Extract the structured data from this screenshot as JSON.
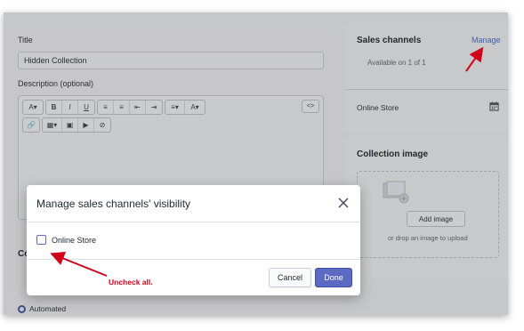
{
  "form": {
    "title_label": "Title",
    "title_value": "Hidden Collection",
    "description_label": "Description (optional)",
    "toolbar": {
      "font": "A",
      "bold": "B",
      "italic": "I",
      "underline": "U",
      "text_color": "A",
      "code": "<>"
    },
    "conditions_heading_partial": "Co",
    "automated_label": "Automated"
  },
  "sales_channels": {
    "title": "Sales channels",
    "manage_link": "Manage",
    "availability": "Available on 1 of 1",
    "channel": "Online Store"
  },
  "collection_image": {
    "title": "Collection image",
    "add_button": "Add image",
    "drop_hint": "or drop an image to upload"
  },
  "modal": {
    "title": "Manage sales channels' visibility",
    "options": [
      {
        "label": "Online Store",
        "checked": false
      }
    ],
    "cancel_label": "Cancel",
    "done_label": "Done"
  },
  "annotation": {
    "text": "Uncheck all.",
    "color": "#d0021b"
  },
  "colors": {
    "primary": "#5c6ac4",
    "link": "#3f5fa8",
    "overlay": "#c6c7c9"
  }
}
